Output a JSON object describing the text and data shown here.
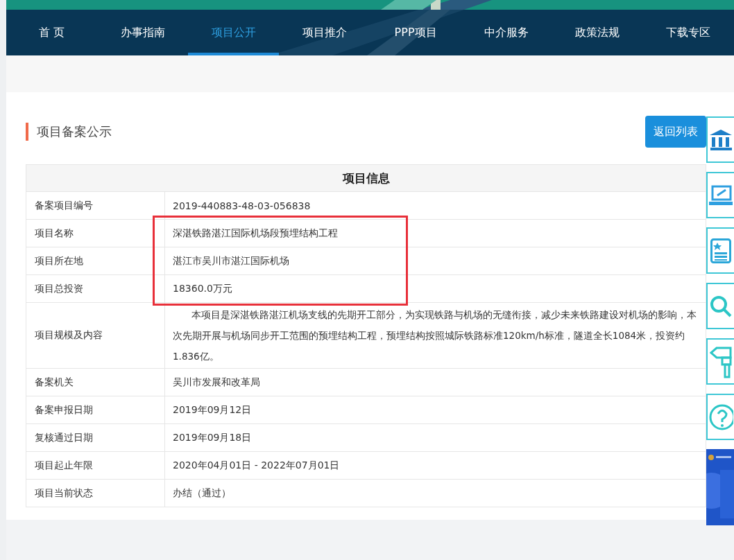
{
  "nav": [
    {
      "label": "首 页",
      "selected": false
    },
    {
      "label": "办事指南",
      "selected": false
    },
    {
      "label": "项目公开",
      "selected": true
    },
    {
      "label": "项目推介",
      "selected": false
    },
    {
      "label": "PPP项目",
      "selected": false
    },
    {
      "label": "中介服务",
      "selected": false
    },
    {
      "label": "政策法规",
      "selected": false
    },
    {
      "label": "下载专区",
      "selected": false
    }
  ],
  "section_title": "项目备案公示",
  "back_button": "返回列表",
  "table": {
    "title": "项目信息",
    "rows": [
      {
        "label": "备案项目编号",
        "value": "2019-440883-48-03-056838",
        "highlighted": false
      },
      {
        "label": "项目名称",
        "value": "深湛铁路湛江国际机场段预埋结构工程",
        "highlighted": true
      },
      {
        "label": "项目所在地",
        "value": "湛江市吴川市湛江国际机场",
        "highlighted": true
      },
      {
        "label": "项目总投资",
        "value": "18360.0万元",
        "highlighted": true
      },
      {
        "label": "项目规模及内容",
        "value": "本项目是深湛铁路湛江机场支线的先期开工部分，为实现铁路与机场的无缝衔接，减少未来铁路建设对机场的影响，本次先期开展与机场同步开工范围的预埋结构工程，预埋结构按照城际铁路标准120km/h标准，隧道全长1084米，投资约1.836亿。",
        "highlighted": false,
        "kind": "paragraph"
      },
      {
        "label": "备案机关",
        "value": "吴川市发展和改革局",
        "highlighted": false
      },
      {
        "label": "备案申报日期",
        "value": "2019年09月12日",
        "highlighted": false
      },
      {
        "label": "复核通过日期",
        "value": "2019年09月18日",
        "highlighted": false
      },
      {
        "label": "项目起止年限",
        "value": "2020年04月01日 - 2022年07月01日",
        "highlighted": false
      },
      {
        "label": "项目当前状态",
        "value": "办结（通过）",
        "highlighted": false
      }
    ]
  },
  "side_tools": [
    {
      "kind": "bank"
    },
    {
      "kind": "laptop"
    },
    {
      "kind": "list"
    },
    {
      "kind": "search"
    },
    {
      "kind": "signpost"
    },
    {
      "kind": "help"
    },
    {
      "kind": "picture"
    }
  ]
}
